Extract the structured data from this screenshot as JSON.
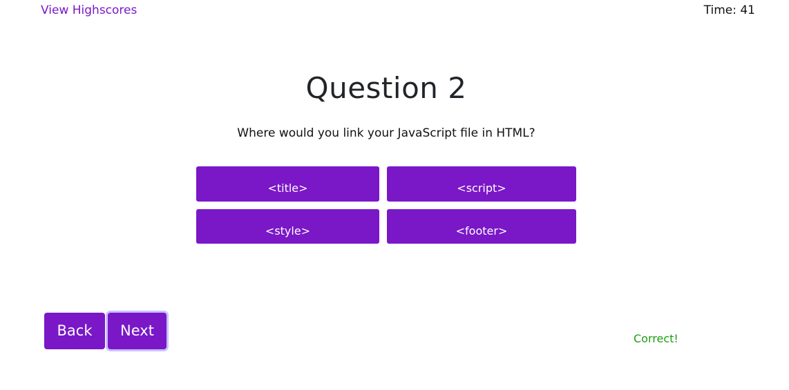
{
  "header": {
    "highscores_label": "View Highscores",
    "timer_text": "Time: 41"
  },
  "question": {
    "title": "Question 2",
    "prompt": "Where would you link your JavaScript file in HTML?"
  },
  "answers": [
    {
      "label": "<title>"
    },
    {
      "label": "<script>"
    },
    {
      "label": "<style>"
    },
    {
      "label": "<footer>"
    }
  ],
  "nav": {
    "back_label": "Back",
    "next_label": "Next"
  },
  "feedback": {
    "text": "Correct!"
  },
  "colors": {
    "accent": "#7a17c7",
    "feedback_correct": "#1f9c13",
    "focus_ring": "#c9c1ff"
  }
}
